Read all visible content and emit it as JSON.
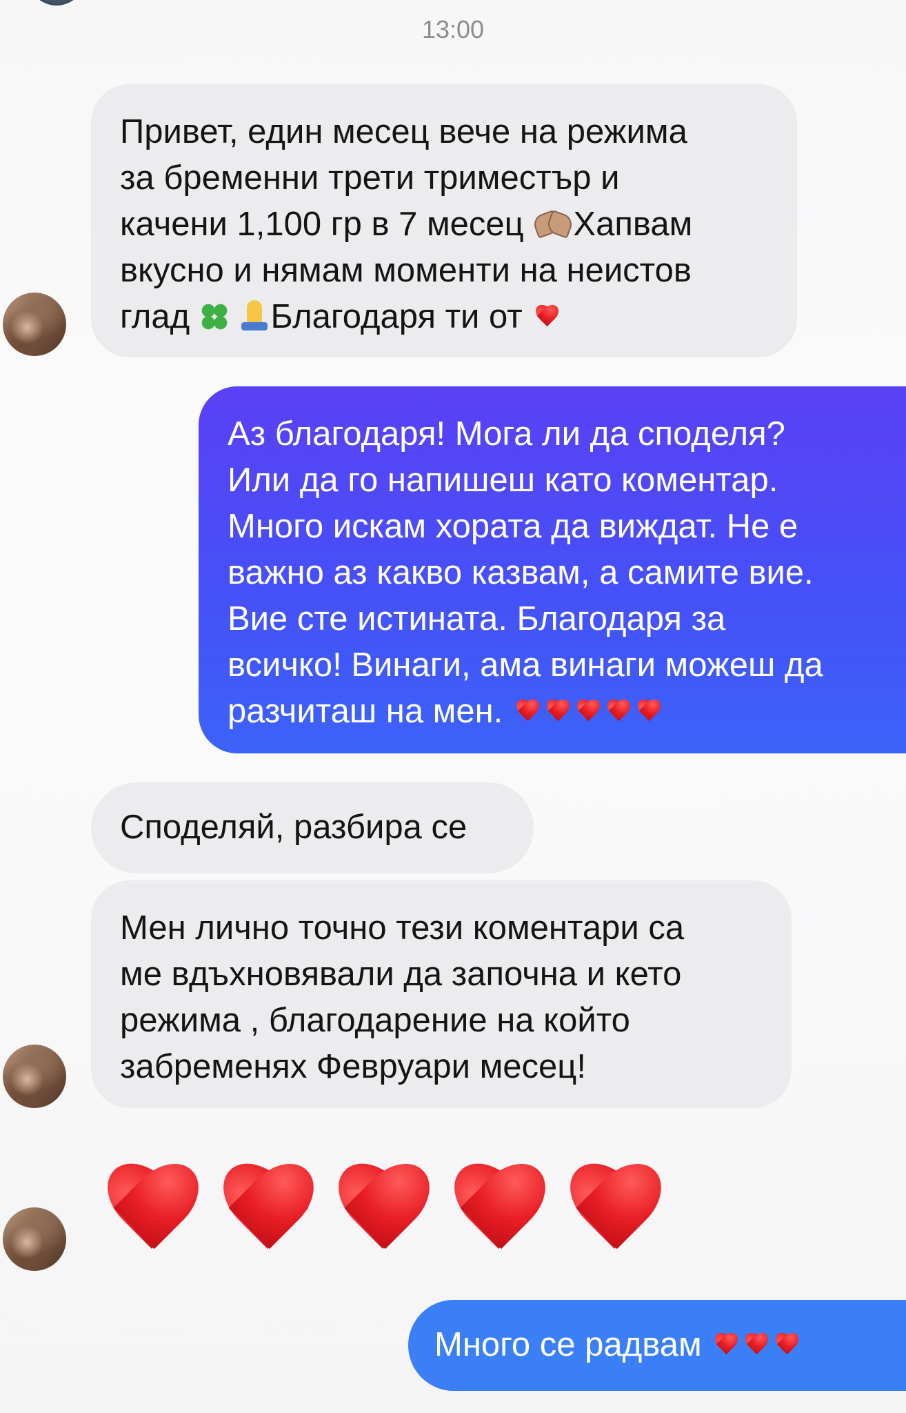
{
  "timestamp": "13:00",
  "messages": [
    {
      "direction": "incoming",
      "lines": [
        "Привет, един месец вече на режима",
        "за бременни трети триместър и",
        "качени 1,100 гр в 7 месец",
        "Хапвам",
        "вкусно и нямам моменти на неистов",
        "глад",
        "Благодаря ти от"
      ],
      "emoji": [
        "heart-hands",
        "four-leaf-clover",
        "folded-hands",
        "red-heart"
      ]
    },
    {
      "direction": "outgoing",
      "text": "Аз благодаря! Мога ли да споделя?\nИли да го напишеш като коментар.\nМного искам хората да виждат. Не е\nважно аз какво казвам, а самите вие.\nВие сте истината. Благодаря за\nвсичко! Винаги, ама винаги можеш да\nразчиташ на мен.",
      "hearts": 5
    },
    {
      "direction": "incoming",
      "text": "Споделяй, разбира се"
    },
    {
      "direction": "incoming",
      "text": "Мен лично точно тези коментари са\nме вдъхновявали да започна и кето\nрежима , благодарение на който\nзабременях Февруари месец!"
    },
    {
      "direction": "incoming",
      "type": "emoji-only",
      "hearts": 5
    },
    {
      "direction": "outgoing",
      "text": "Много се радвам",
      "hearts": 3
    }
  ],
  "colors": {
    "incoming_bubble": "#ececee",
    "outgoing_purple": "#4a52f7",
    "outgoing_blue": "#3b7ff7",
    "timestamp": "#8a8c91"
  }
}
